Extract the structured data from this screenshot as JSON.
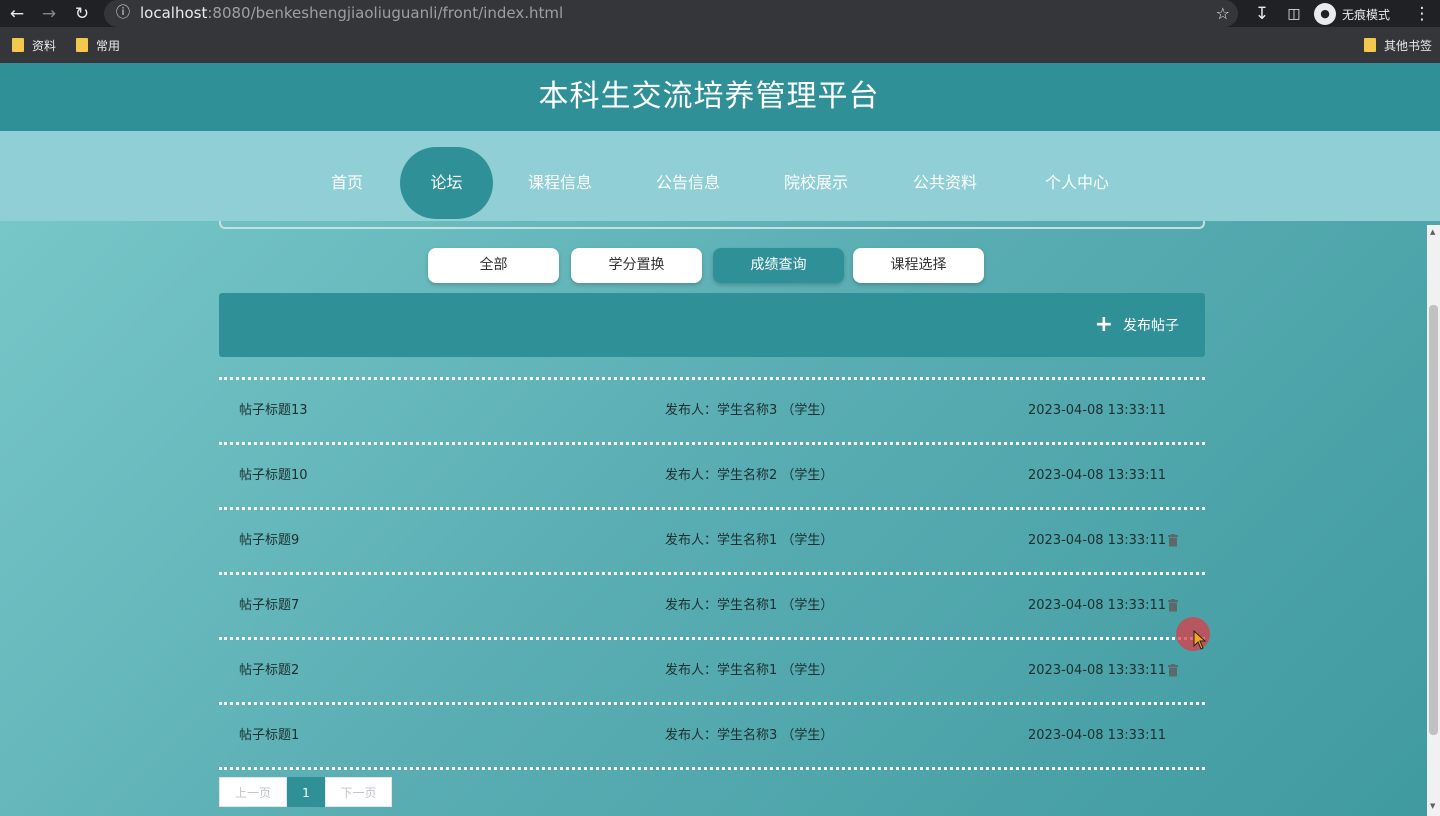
{
  "browser": {
    "url_host": "localhost",
    "url_path": ":8080/benkeshengjiaoliuguanli/front/index.html",
    "incognito_label": "无痕模式",
    "bookmarks": [
      "资料",
      "常用"
    ],
    "other_bookmarks": "其他书签"
  },
  "site": {
    "title": "本科生交流培养管理平台"
  },
  "nav": {
    "items": [
      "首页",
      "论坛",
      "课程信息",
      "公告信息",
      "院校展示",
      "公共资料",
      "个人中心"
    ],
    "active_index": 1
  },
  "categories": {
    "items": [
      "全部",
      "学分置换",
      "成绩查询",
      "课程选择"
    ],
    "active_index": 2
  },
  "toolbar": {
    "publish_label": "发布帖子"
  },
  "posts": [
    {
      "title": "帖子标题13",
      "author": "发布人：学生名称3 （学生）",
      "time": "2023-04-08 13:33:11",
      "deletable": false
    },
    {
      "title": "帖子标题10",
      "author": "发布人：学生名称2 （学生）",
      "time": "2023-04-08 13:33:11",
      "deletable": false
    },
    {
      "title": "帖子标题9",
      "author": "发布人：学生名称1 （学生）",
      "time": "2023-04-08 13:33:11",
      "deletable": true
    },
    {
      "title": "帖子标题7",
      "author": "发布人：学生名称1 （学生）",
      "time": "2023-04-08 13:33:11",
      "deletable": true
    },
    {
      "title": "帖子标题2",
      "author": "发布人：学生名称1 （学生）",
      "time": "2023-04-08 13:33:11",
      "deletable": true
    },
    {
      "title": "帖子标题1",
      "author": "发布人：学生名称3 （学生）",
      "time": "2023-04-08 13:33:11",
      "deletable": false
    }
  ],
  "pagination": {
    "prev_label": "上一页",
    "current_page": "1",
    "next_label": "下一页"
  },
  "colors": {
    "primary": "#2f9197",
    "nav_bg": "#8fcfd5"
  }
}
